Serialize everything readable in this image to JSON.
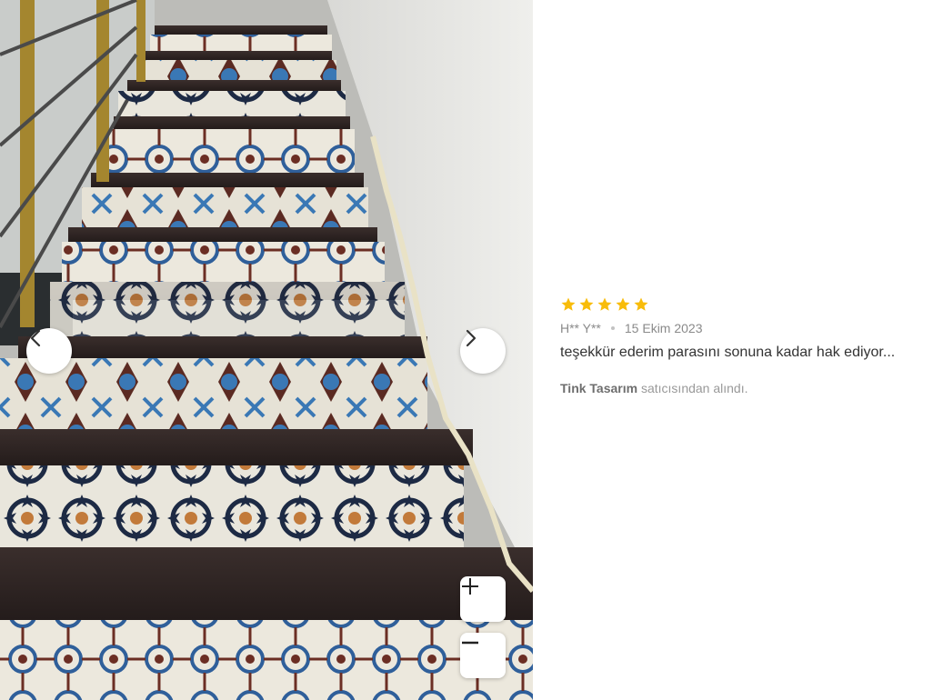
{
  "review": {
    "rating": 5,
    "max_rating": 5,
    "star_color": "#F8BC0A",
    "reviewer": "H** Y**",
    "date": "15 Ekim 2023",
    "comment": "teşekkür ederim parasını sonuna kadar hak ediyor...",
    "seller_name": "Tink Tasarım",
    "seller_suffix": "satıcısından alındı."
  },
  "gallery": {
    "icons": {
      "prev": "chevron-left-icon",
      "next": "chevron-right-icon",
      "zoom_in": "plus-icon",
      "zoom_out": "minus-icon"
    }
  }
}
